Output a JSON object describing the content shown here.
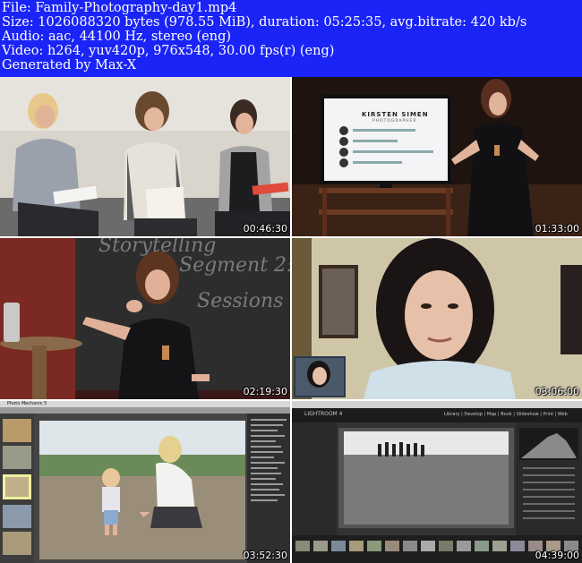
{
  "info": {
    "file_line": "File: Family-Photography-day1.mp4",
    "size_line": "Size: 1026088320 bytes (978.55 MiB), duration: 05:25:35, avg.bitrate: 420 kb/s",
    "audio_line": "Audio: aac, 44100 Hz, stereo (eng)",
    "video_line": "Video: h264, yuv420p, 976x548, 30.00 fps(r) (eng)",
    "generated_line": "Generated by Max-X"
  },
  "thumbnails": [
    {
      "timestamp": "00:46:30"
    },
    {
      "timestamp": "01:33:00",
      "screen_brand": "KIRSTEN SIMEN",
      "screen_sub": "PHOTOGRAPHER"
    },
    {
      "timestamp": "02:19:30",
      "board_text_1": "Storytelling",
      "board_text_2": "Segment 2:",
      "board_text_3": "Sessions"
    },
    {
      "timestamp": "03:06:00"
    },
    {
      "timestamp": "03:52:30",
      "app_title": "Photo Mechanic 5"
    },
    {
      "timestamp": "04:39:00",
      "app_title": "LIGHTROOM 4",
      "modules": "Library | Develop | Map | Book | Slideshow | Print | Web"
    }
  ],
  "colors": {
    "header_background": "#1a24f6",
    "header_text": "#ffffff",
    "timestamp_text": "#ffffff"
  }
}
